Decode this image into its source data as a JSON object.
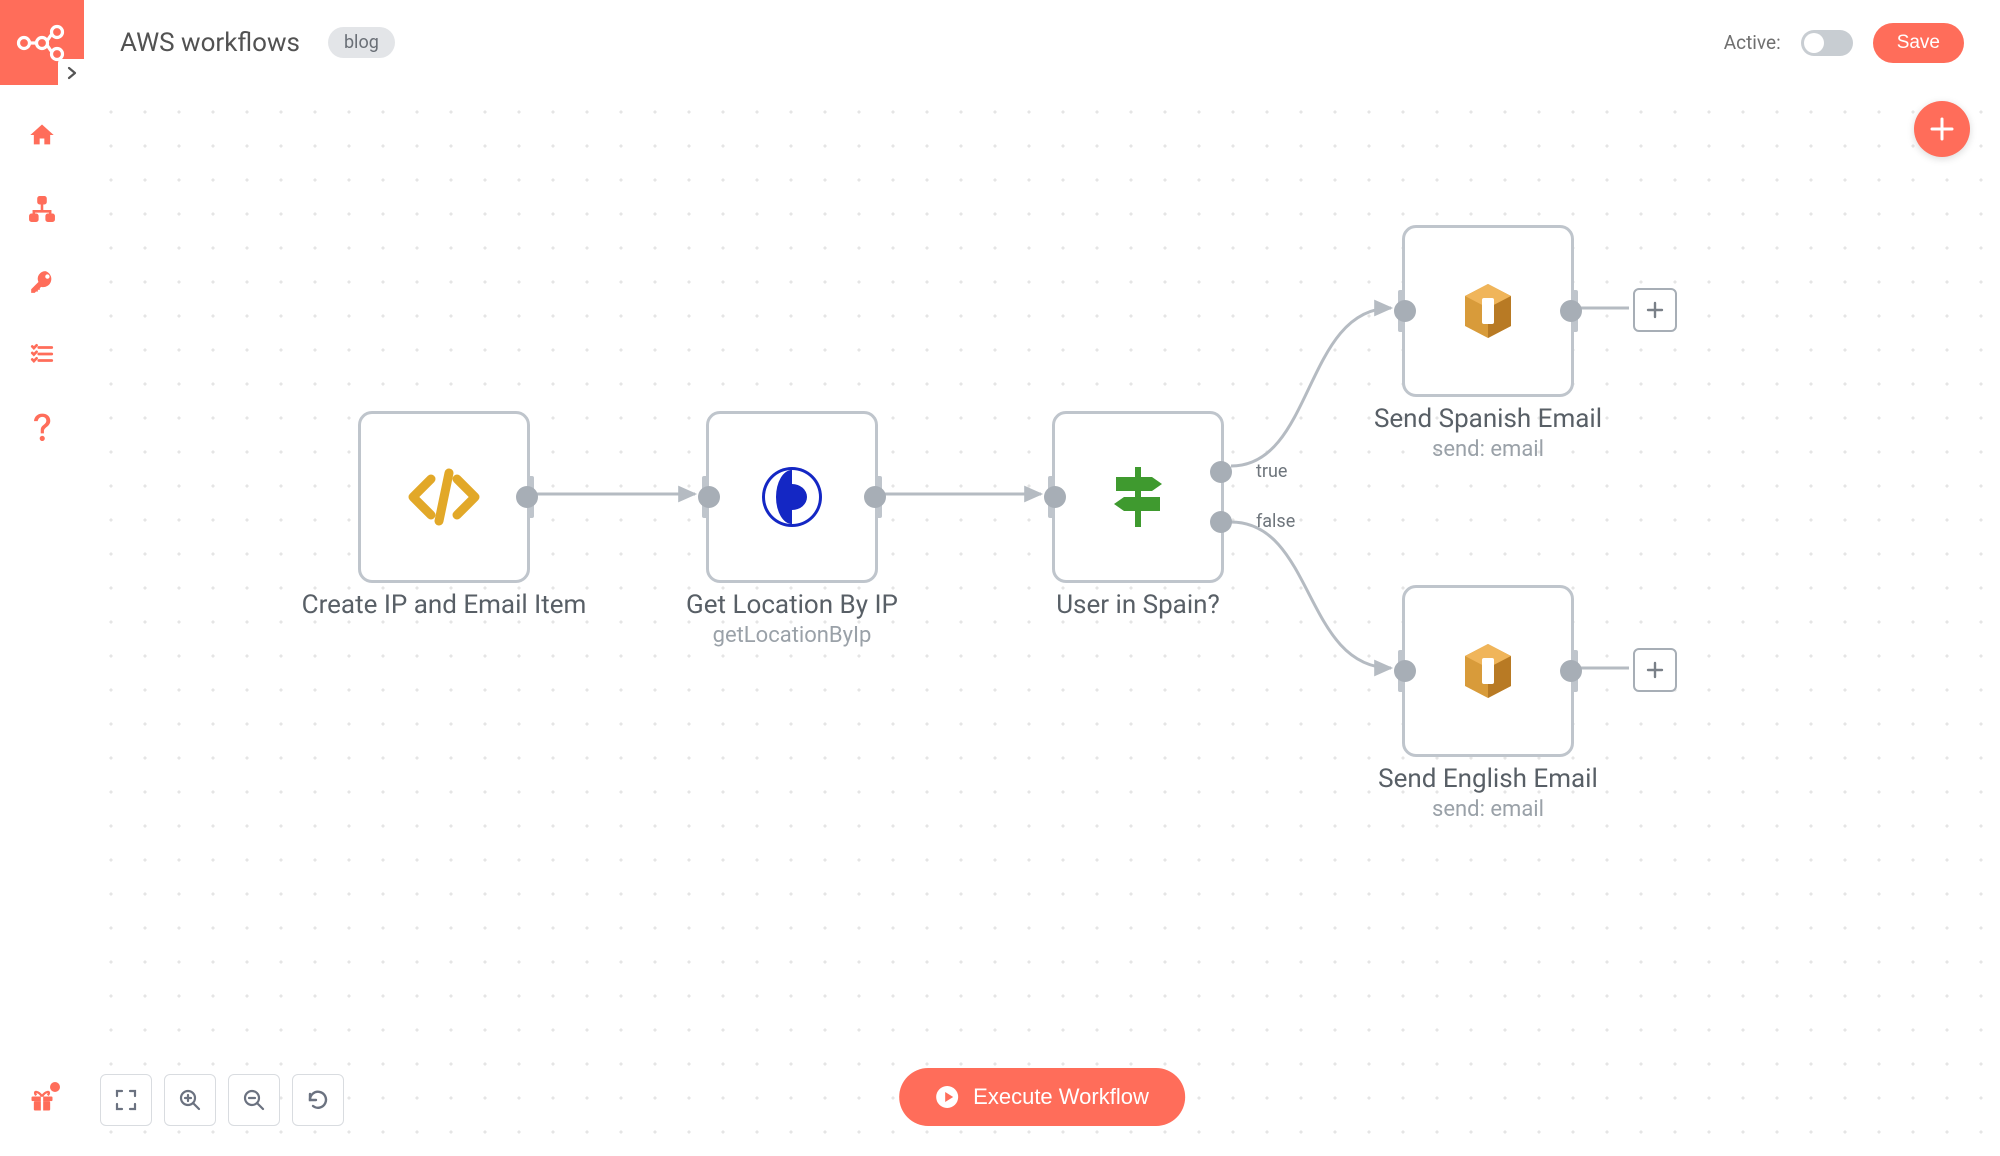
{
  "header": {
    "title": "AWS workflows",
    "tag": "blog",
    "active_label": "Active:",
    "save_label": "Save"
  },
  "sidebar": {
    "items": [
      {
        "name": "home"
      },
      {
        "name": "workflows"
      },
      {
        "name": "credentials"
      },
      {
        "name": "executions"
      },
      {
        "name": "help"
      }
    ],
    "bottom": {
      "name": "gift"
    }
  },
  "canvas": {
    "execute_label": "Execute Workflow",
    "fab_label": "+"
  },
  "nodes": {
    "n1": {
      "title": "Create IP and Email Item",
      "sub": ""
    },
    "n2": {
      "title": "Get Location By IP",
      "sub": "getLocationByIp"
    },
    "n3": {
      "title": "User in Spain?",
      "sub": "",
      "true_label": "true",
      "false_label": "false"
    },
    "n4": {
      "title": "Send Spanish Email",
      "sub": "send: email"
    },
    "n5": {
      "title": "Send English Email",
      "sub": "send: email"
    }
  },
  "colors": {
    "accent": "#ff6d5a"
  }
}
